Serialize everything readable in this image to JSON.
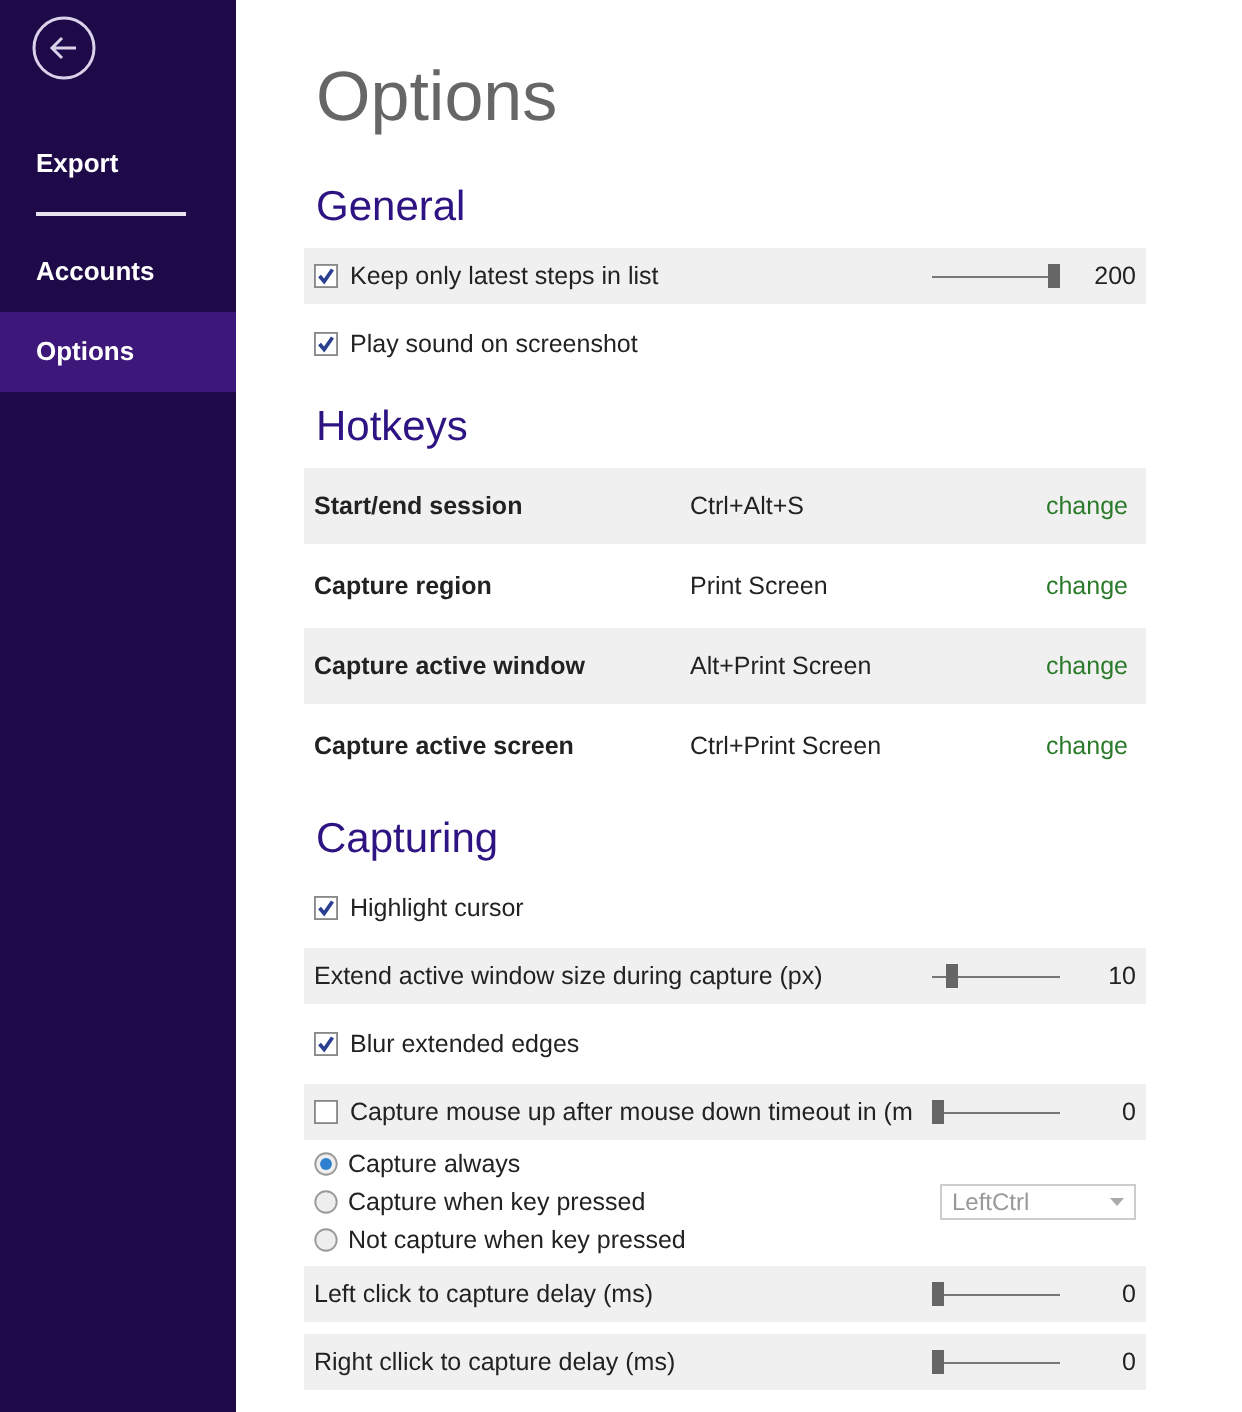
{
  "sidebar": {
    "items": [
      {
        "label": "Export",
        "selected": false,
        "divider_after": true
      },
      {
        "label": "Accounts",
        "selected": false,
        "divider_after": false
      },
      {
        "label": "Options",
        "selected": true,
        "divider_after": false
      }
    ]
  },
  "title": "Options",
  "sections": [
    {
      "heading": "General",
      "rows": [
        {
          "kind": "check",
          "label": "Keep only latest steps in list",
          "checked": true,
          "level": 1,
          "reading": "200"
        },
        {
          "kind": "check",
          "label": "Play sound on screenshot",
          "checked": true
        }
      ]
    },
    {
      "heading": "Hotkeys",
      "rows": [
        {
          "kind": "hotkey",
          "action": "Start/end session",
          "keys": "Ctrl+Alt+S",
          "link": "change"
        },
        {
          "kind": "hotkey",
          "action": "Capture region",
          "keys": "Print Screen",
          "link": "change"
        },
        {
          "kind": "hotkey",
          "action": "Capture active window",
          "keys": "Alt+Print Screen",
          "link": "change"
        },
        {
          "kind": "hotkey",
          "action": "Capture active screen",
          "keys": "Ctrl+Print Screen",
          "link": "change"
        }
      ]
    },
    {
      "heading": "Capturing",
      "rows": [
        {
          "kind": "check",
          "label": "Highlight cursor",
          "checked": true
        },
        {
          "kind": "slider",
          "label": "Extend active window size during capture (px)",
          "level": 0.12,
          "reading": "10"
        },
        {
          "kind": "check",
          "label": "Blur extended edges",
          "checked": true
        },
        {
          "kind": "check",
          "label": "Capture mouse up after mouse down timeout in (m",
          "checked": false,
          "level": 0,
          "reading": "0"
        },
        {
          "kind": "radio",
          "options": [
            {
              "label": "Capture always",
              "selected": true
            },
            {
              "label": "Capture when key pressed",
              "selected": false,
              "dropdown": {
                "value": "LeftCtrl",
                "disabled": true
              }
            },
            {
              "label": "Not capture when key pressed",
              "selected": false
            }
          ]
        },
        {
          "kind": "slider",
          "label": "Left click to capture delay (ms)",
          "level": 0,
          "reading": "0"
        },
        {
          "kind": "slider",
          "label": "Right cllick to capture delay (ms)",
          "level": 0,
          "reading": "0"
        }
      ]
    }
  ]
}
